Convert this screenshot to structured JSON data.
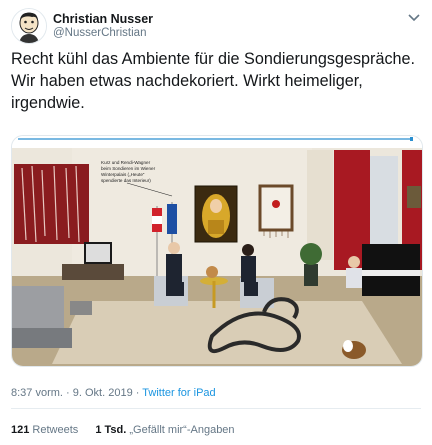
{
  "author": {
    "name": "Christian Nusser",
    "handle": "@NusserChristian"
  },
  "tweet": {
    "text": "Recht kühl das Ambiente für die Sondierungsgespräche. Wir haben etwas nachdekoriert. Wirkt heimeliger, irgendwie."
  },
  "media": {
    "caption_lines": [
      "Kurz und Rendi-Wagner",
      "beim Sondieren im Wiener",
      "Winterpalais („Heute“",
      "spendierte das Interieur)"
    ]
  },
  "meta": {
    "time": "8:37 vorm.",
    "separator": "·",
    "date": "9. Okt. 2019",
    "source": "Twitter for iPad"
  },
  "stats": {
    "retweets_count": "121",
    "retweets_label": "Retweets",
    "likes_count": "1 Tsd.",
    "likes_label": "„Gefällt mir“-Angaben"
  },
  "colors": {
    "link": "#1b95e0",
    "muted": "#657786",
    "text": "#14171a"
  },
  "icons": [
    "avatar-caricature",
    "chevron-down-icon"
  ]
}
